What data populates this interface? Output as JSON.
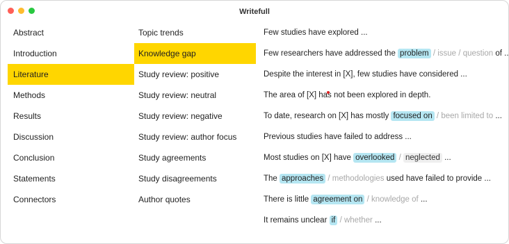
{
  "window": {
    "title": "Writefull",
    "colors": {
      "close": "#ff5f57",
      "minimize": "#febc2e",
      "zoom": "#28c840",
      "selected": "#ffd600",
      "highlight": "#b5e6f2"
    }
  },
  "sections": [
    {
      "label": "Abstract"
    },
    {
      "label": "Introduction"
    },
    {
      "label": "Literature",
      "selected": true
    },
    {
      "label": "Methods"
    },
    {
      "label": "Results"
    },
    {
      "label": "Discussion"
    },
    {
      "label": "Conclusion"
    },
    {
      "label": "Statements"
    },
    {
      "label": "Connectors"
    }
  ],
  "categories": [
    {
      "label": "Topic trends"
    },
    {
      "label": "Knowledge gap",
      "selected": true
    },
    {
      "label": "Study review: positive"
    },
    {
      "label": "Study review: neutral"
    },
    {
      "label": "Study review: negative"
    },
    {
      "label": "Study review: author focus"
    },
    {
      "label": "Study agreements"
    },
    {
      "label": "Study disagreements"
    },
    {
      "label": "Author quotes"
    }
  ],
  "phrases": {
    "p1": {
      "text": "Few studies have explored ..."
    },
    "p2": {
      "pre": "Few researchers have addressed the ",
      "hl": "problem",
      "alt1": "issue",
      "alt2": "question",
      "post": " of ..."
    },
    "p3": {
      "text": "Despite the interest in [X], few studies have considered ..."
    },
    "p4": {
      "text": "The area of [X] has not been explored in depth."
    },
    "p5": {
      "pre": "To date, research on [X] has mostly ",
      "hl": "focused on",
      "alt1": "been limited to",
      "post": " ..."
    },
    "p6": {
      "text": "Previous studies have failed to address ..."
    },
    "p7": {
      "pre": "Most studies on [X] have ",
      "hl": "overlooked",
      "alt1": "neglected",
      "post": " ..."
    },
    "p8": {
      "pre": "The ",
      "hl": "approaches",
      "alt1": "methodologies",
      "post": " used have failed to provide ..."
    },
    "p9": {
      "pre": "There is little ",
      "hl": "agreement on",
      "alt1": "knowledge of",
      "post": " ..."
    },
    "p10": {
      "pre": "It remains unclear ",
      "hl": "if",
      "alt1": "whether",
      "post": " ..."
    }
  },
  "separator": "/"
}
